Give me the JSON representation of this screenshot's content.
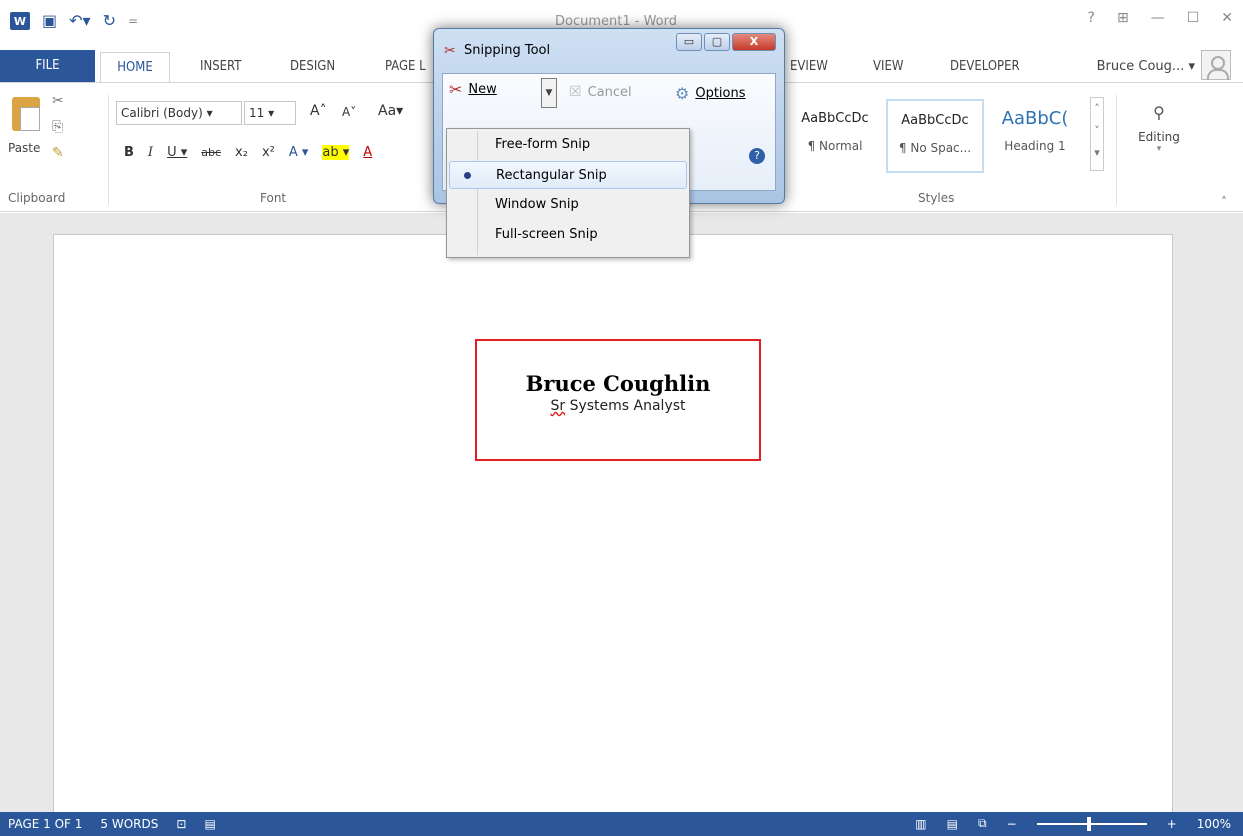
{
  "titlebar": {
    "doc_title": "Document1 - Word",
    "qat_save_icon": "save-icon",
    "qat_undo_icon": "undo-icon",
    "qat_redo_icon": "redo-icon"
  },
  "tabs": {
    "file": "FILE",
    "home": "HOME",
    "insert": "INSERT",
    "design": "DESIGN",
    "page_layout": "PAGE L",
    "review": "EVIEW",
    "view": "VIEW",
    "developer": "DEVELOPER",
    "user": "Bruce Coug..."
  },
  "ribbon": {
    "paste": "Paste",
    "clipboard_group": "Clipboard",
    "font_name": "Calibri (Body)",
    "font_size": "11",
    "change_case": "Aa",
    "font_group": "Font",
    "styles": [
      {
        "sample": "AaBbCcDc",
        "name": "¶ Normal"
      },
      {
        "sample": "AaBbCcDc",
        "name": "¶ No Spac..."
      },
      {
        "sample": "AaBbC(",
        "name": "Heading 1"
      }
    ],
    "styles_group": "Styles",
    "editing": "Editing"
  },
  "document": {
    "name": "Bruce Coughlin",
    "title_prefix": "Sr",
    "title_rest": " Systems Analyst"
  },
  "status": {
    "page": "PAGE 1 OF 1",
    "words": "5 WORDS",
    "zoom": "100%"
  },
  "snipping_tool": {
    "title": "Snipping Tool",
    "new": "New",
    "cancel": "Cancel",
    "options": "Options",
    "menu": [
      {
        "label": "Free-form Snip",
        "selected": false
      },
      {
        "label": "Rectangular Snip",
        "selected": true
      },
      {
        "label": "Window Snip",
        "selected": false
      },
      {
        "label": "Full-screen Snip",
        "selected": false
      }
    ]
  },
  "colors": {
    "word_blue": "#2b579a",
    "highlight_red": "#e02020"
  }
}
